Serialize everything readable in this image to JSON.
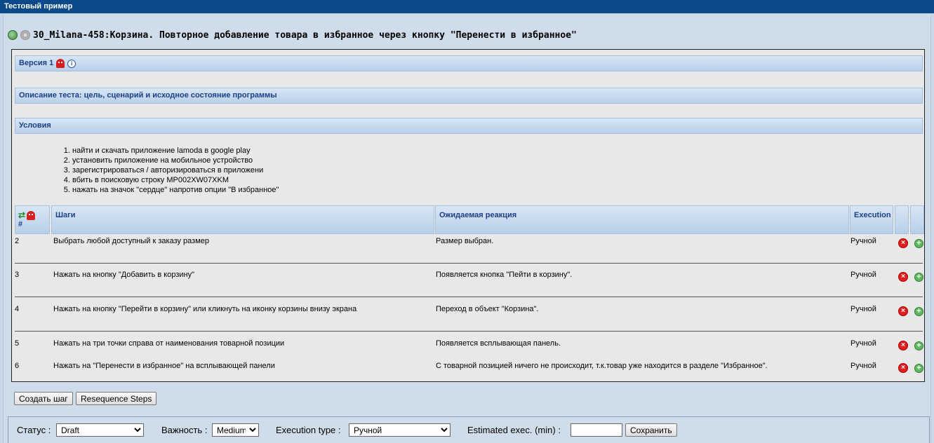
{
  "window": {
    "title": "Тестовый пример"
  },
  "heading": {
    "title": "30_Milana-458:Корзина. Повторное добавление товара в избранное через кнопку \"Перенести в избранное\""
  },
  "version": {
    "label": "Версия 1"
  },
  "description": {
    "label": "Описание теста: цель, сценарий и исходное состояние программы"
  },
  "conditions": {
    "label": "Условия",
    "items": [
      "найти и скачать приложение lamoda  в google play",
      "установить приложение на мобильное устройство",
      "зарегистрироваться / авторизироваться в приложени",
      "вбить в поисковую строку MP002XW07XKM",
      "нажать на значок \"сердце\" напротив опции \"В избранное\""
    ]
  },
  "steps_table": {
    "headers": {
      "num": "#",
      "steps": "Шаги",
      "expected": "Ожидаемая реакция",
      "execution": "Execution"
    },
    "rows": [
      {
        "num": "2",
        "step": "Выбрать любой доступный к заказу размер",
        "expected": "Размер выбран.",
        "execution": "Ручной"
      },
      {
        "num": "3",
        "step": "Нажать на кнопку \"Добавить в корзину\"",
        "expected": "Появляется кнопка \"Пейти в корзину\".",
        "execution": "Ручной"
      },
      {
        "num": "4",
        "step": "Нажать на кнопку \"Перейти в корзину\" или кликнуть на иконку корзины внизу экрана",
        "expected": "Переход в объект \"Корзина\".",
        "execution": "Ручной"
      },
      {
        "num": "5",
        "step": "Нажать на три точки справа от наименования товарной позиции",
        "expected": "Появляется всплывающая панель.",
        "execution": "Ручной"
      },
      {
        "num": "6",
        "step": "Нажать на \"Перенести в избранное\" на всплывающей панели",
        "expected": "С товарной позицией ничего не происходит, т.к.товар уже находится в разделе \"Избранное\".",
        "execution": "Ручной"
      }
    ]
  },
  "buttons": {
    "create_step": "Создать шаг",
    "resequence": "Resequence Steps"
  },
  "bottom": {
    "status_label": "Статус :",
    "status_value": "Draft",
    "importance_label": "Важность :",
    "importance_value": "Medium",
    "exec_type_label": "Execution type :",
    "exec_type_value": "Ручной",
    "estimated_label": "Estimated exec. (min) :",
    "estimated_value": "",
    "save_label": "Сохранить"
  },
  "colors": {
    "titlebar": "#0a4a8a",
    "header_text": "#1c3f86",
    "background": "#cfdcea"
  }
}
